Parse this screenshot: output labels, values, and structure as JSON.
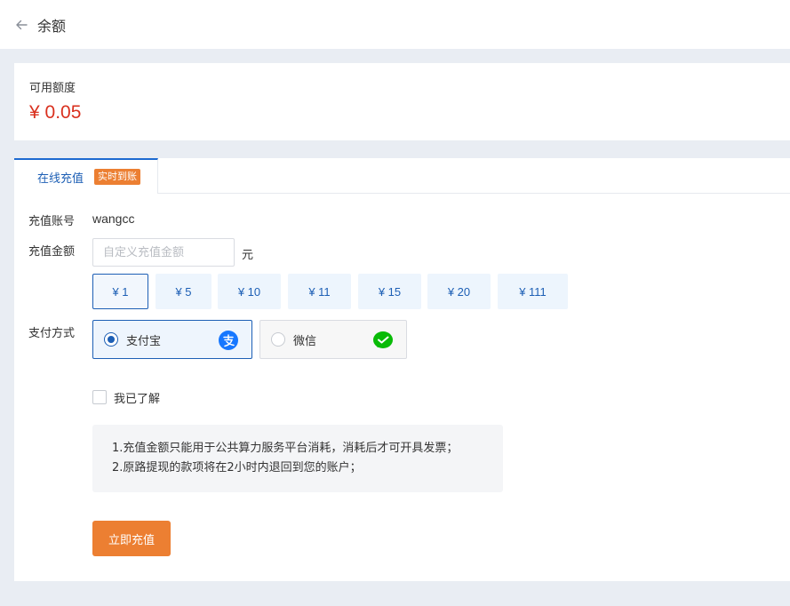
{
  "header": {
    "title": "余额",
    "back_icon": "arrow-left-icon"
  },
  "balance": {
    "label": "可用额度",
    "value": "¥ 0.05",
    "value_color": "#d9301e"
  },
  "tabs": [
    {
      "label": "在线充值",
      "badge": "实时到账",
      "active": true
    }
  ],
  "form": {
    "account_label": "充值账号",
    "account_value": "wangcc",
    "amount_label": "充值金额",
    "amount_placeholder": "自定义充值金额",
    "amount_value": "",
    "amount_unit": "元",
    "presets": [
      {
        "label": "¥ 1",
        "selected": true
      },
      {
        "label": "¥ 5",
        "selected": false
      },
      {
        "label": "¥ 10",
        "selected": false
      },
      {
        "label": "¥ 11",
        "selected": false
      },
      {
        "label": "¥ 15",
        "selected": false
      },
      {
        "label": "¥ 20",
        "selected": false
      },
      {
        "label": "¥ 111",
        "selected": false
      }
    ],
    "payment_label": "支付方式",
    "payment_methods": [
      {
        "label": "支付宝",
        "icon": "alipay-icon",
        "selected": true
      },
      {
        "label": "微信",
        "icon": "wechat-pay-icon",
        "selected": false
      }
    ],
    "agree_label": "我已了解",
    "agree_checked": false,
    "notice_lines": [
      "1.充值金额只能用于公共算力服务平台消耗，消耗后才可开具发票；",
      "2.原路提现的款项将在2小时内退回到您的账户；"
    ],
    "submit_label": "立即充值"
  },
  "colors": {
    "accent": "#1d5fb5",
    "primary_button": "#ec7f32",
    "badge": "#ec7f32"
  }
}
